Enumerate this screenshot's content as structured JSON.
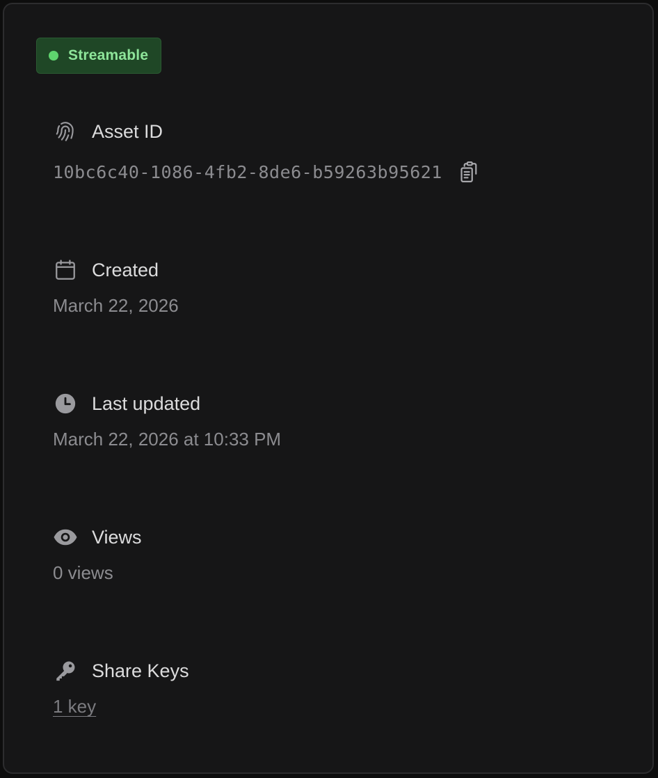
{
  "status_badge": {
    "label": "Streamable",
    "dot_color": "#5fd46e",
    "background": "#1f4726",
    "text_color": "#8ee59a"
  },
  "asset_id": {
    "title": "Asset ID",
    "icon": "fingerprint-icon",
    "value": "10bc6c40-1086-4fb2-8de6-b59263b95621",
    "copy_icon": "clipboard-copy-icon"
  },
  "created": {
    "title": "Created",
    "icon": "calendar-icon",
    "value": "March 22, 2026"
  },
  "last_updated": {
    "title": "Last updated",
    "icon": "clock-icon",
    "value": "March 22, 2026 at 10:33 PM"
  },
  "views": {
    "title": "Views",
    "icon": "eye-icon",
    "value": "0 views"
  },
  "share_keys": {
    "title": "Share Keys",
    "icon": "key-icon",
    "value": "1 key"
  }
}
